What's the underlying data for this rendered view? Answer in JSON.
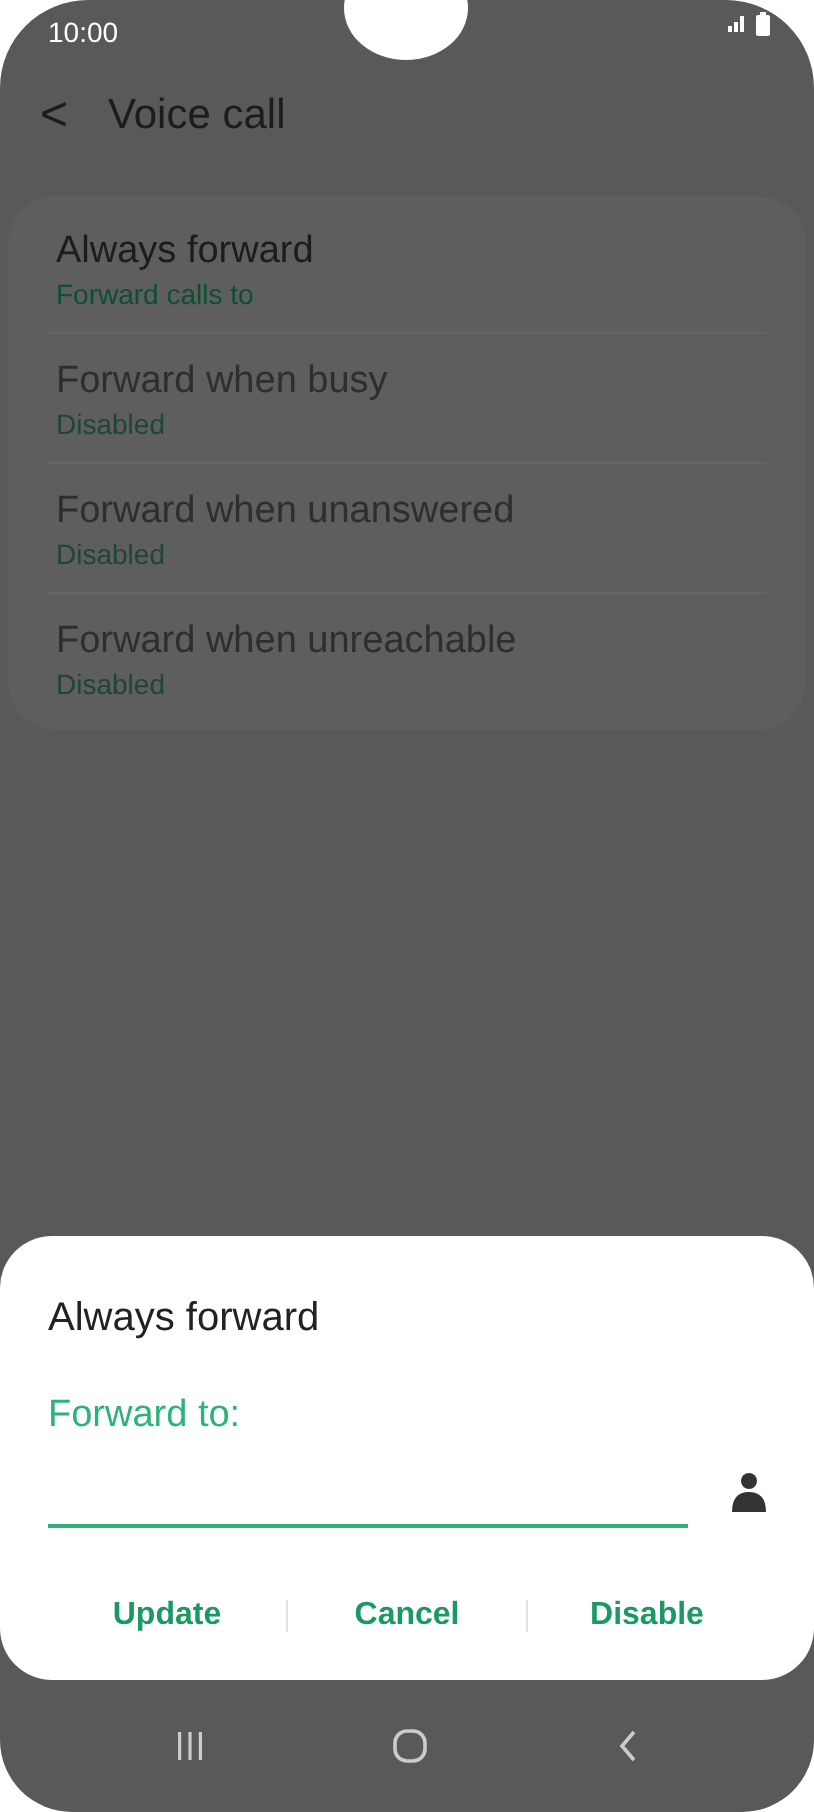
{
  "status_bar": {
    "time": "10:00"
  },
  "header": {
    "back": "<",
    "title": "Voice call"
  },
  "options": [
    {
      "title": "Always forward",
      "subtitle": "Forward calls to",
      "disabled": false
    },
    {
      "title": "Forward when busy",
      "subtitle": "Disabled",
      "disabled": true
    },
    {
      "title": "Forward when unanswered",
      "subtitle": "Disabled",
      "disabled": true
    },
    {
      "title": "Forward when unreachable",
      "subtitle": "Disabled",
      "disabled": true
    }
  ],
  "dialog": {
    "title": "Always forward",
    "field_label": "Forward to:",
    "buttons": [
      "Update",
      "Cancel",
      "Disable"
    ]
  }
}
